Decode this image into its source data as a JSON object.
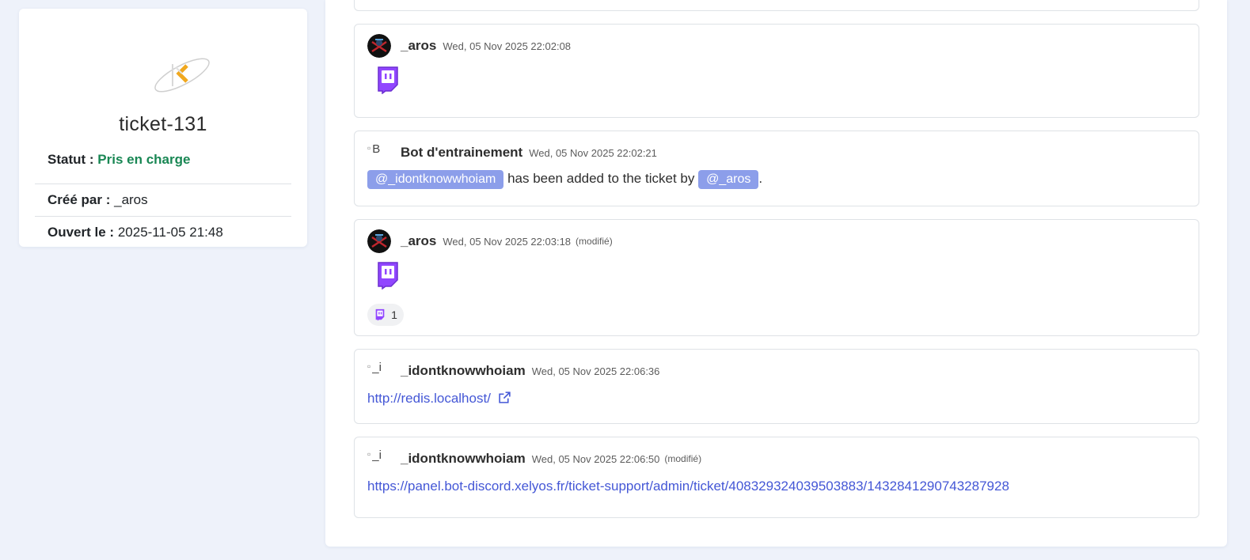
{
  "ticket": {
    "title": "ticket-131",
    "status_label": "Statut :",
    "status_value": "Pris en charge",
    "creator_label": "Créé par :",
    "creator_value": "_aros",
    "opened_label": "Ouvert le :",
    "opened_value": "2025-11-05 21:48"
  },
  "colors": {
    "status": "#198754",
    "mention_bg": "#8c9eea",
    "link": "#4457d6",
    "emote_purple": "#9146ff"
  },
  "messages": [
    {
      "author": "_aros",
      "time": "Wed, 05 Nov 2025 22:02:08",
      "avatar": "dark-avatar",
      "emote": "twitch-icon"
    },
    {
      "author": "Bot d'entrainement",
      "time": "Wed, 05 Nov 2025 22:02:21",
      "avatar_alt": "B",
      "mention1": "@_idontknowwhoiam",
      "text_mid": "has been added to the ticket by",
      "mention2": "@_aros",
      "text_end": "."
    },
    {
      "author": "_aros",
      "time": "Wed, 05 Nov 2025 22:03:18",
      "edited": "(modifié)",
      "avatar": "dark-avatar",
      "emote": "twitch-icon",
      "reaction_count": "1"
    },
    {
      "author": "_idontknowwhoiam",
      "time": "Wed, 05 Nov 2025 22:06:36",
      "avatar_alt": "_i",
      "link": "http://redis.localhost/"
    },
    {
      "author": "_idontknowwhoiam",
      "time": "Wed, 05 Nov 2025 22:06:50",
      "edited": "(modifié)",
      "avatar_alt": "_i",
      "link": "https://panel.bot-discord.xelyos.fr/ticket-support/admin/ticket/408329324039503883/1432841290743287928"
    }
  ]
}
